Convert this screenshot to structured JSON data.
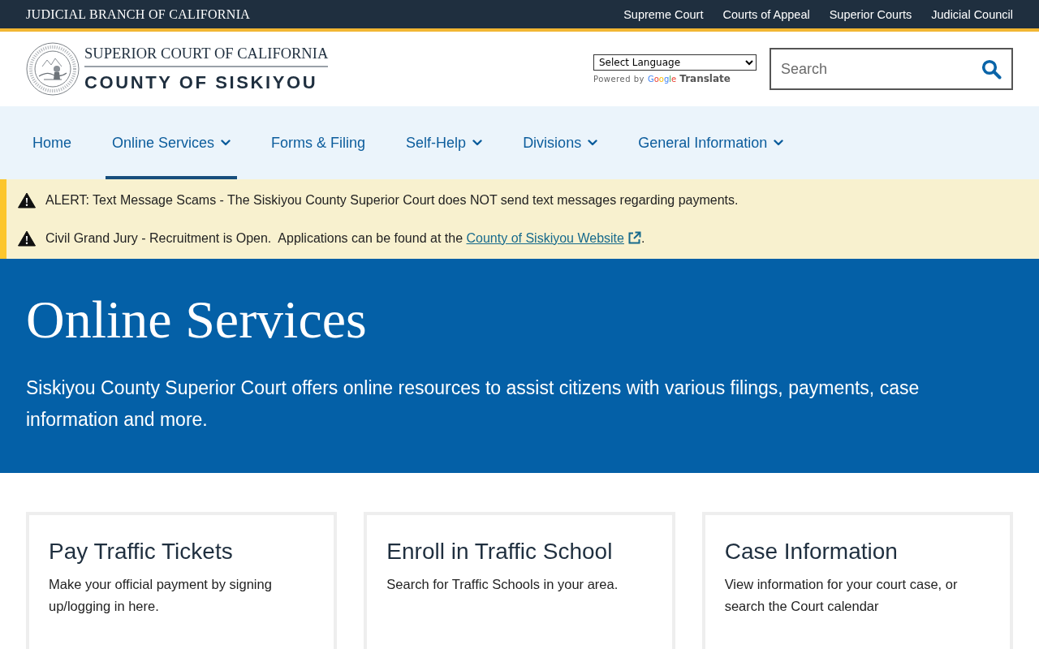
{
  "top_bar": {
    "title": "JUDICIAL BRANCH OF CALIFORNIA",
    "links": [
      "Supreme Court",
      "Courts of Appeal",
      "Superior Courts",
      "Judicial Council"
    ]
  },
  "header": {
    "logo": {
      "line_1": "SUPERIOR COURT OF CALIFORNIA",
      "line_2": "COUNTY OF SISKIYOU"
    },
    "translate": {
      "select": "Select Language",
      "powered_by": "Powered by",
      "brand": "Google",
      "label": "Translate"
    },
    "search": {
      "placeholder": "Search"
    }
  },
  "nav": [
    {
      "label": "Home",
      "has_menu": false,
      "selected": false
    },
    {
      "label": "Online Services",
      "has_menu": true,
      "selected": true
    },
    {
      "label": "Forms & Filing",
      "has_menu": false,
      "selected": false
    },
    {
      "label": "Self-Help",
      "has_menu": true,
      "selected": false
    },
    {
      "label": "Divisions",
      "has_menu": true,
      "selected": false
    },
    {
      "label": "General Information",
      "has_menu": true,
      "selected": false
    }
  ],
  "alerts": [
    {
      "text": "ALERT: Text Message Scams - The Siskiyou County Superior Court does NOT send text messages regarding payments."
    },
    {
      "text": "Civil Grand Jury - Recruitment is Open.  Applications can be found at the ",
      "link": "County of Siskiyou Website",
      "after": "."
    }
  ],
  "hero": {
    "title": "Online Services",
    "text": "Siskiyou County Superior Court offers online resources to assist citizens with various filings, payments, case information and more."
  },
  "cards": [
    {
      "title": "Pay Traffic Tickets",
      "text": "Make your official payment by signing up/logging in here."
    },
    {
      "title": "Enroll in Traffic School",
      "text": "Search for Traffic Schools in your area."
    },
    {
      "title": "Case Information",
      "text": "View information for your court case, or search the Court calendar"
    }
  ]
}
